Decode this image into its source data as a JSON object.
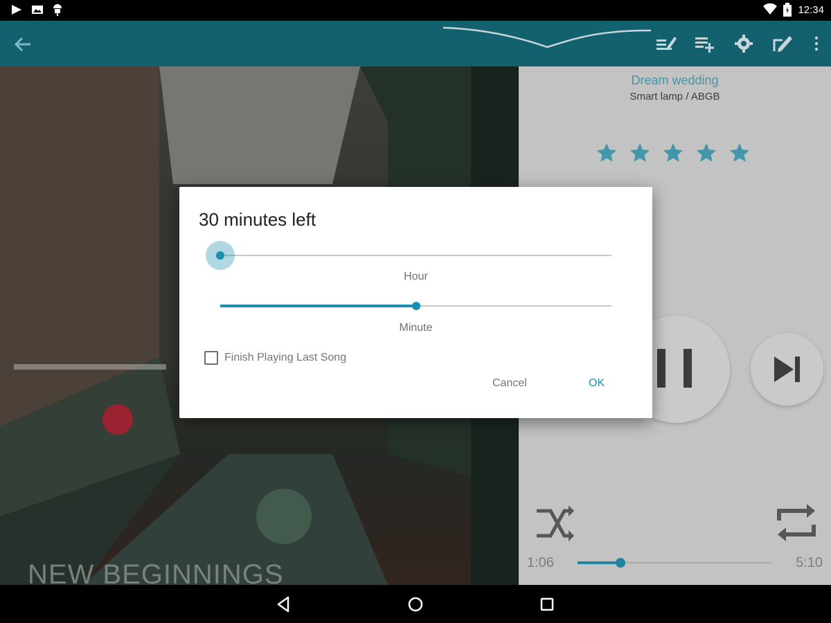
{
  "status_bar": {
    "time": "12:34",
    "icons": [
      "play-store-icon",
      "photo-icon",
      "android-icon",
      "wifi-icon",
      "battery-icon"
    ]
  },
  "app_bar": {
    "icons": [
      "back-arrow-icon",
      "edit-tags-icon",
      "playlist-add-icon",
      "gear-icon",
      "edit-icon",
      "more-vert-icon"
    ]
  },
  "album": {
    "text": "NEW BEGINNINGS"
  },
  "player": {
    "track_title": "Dream wedding",
    "track_subtitle": "Smart lamp / ABGB",
    "rating": 5,
    "rating_max": 5,
    "current_time": "1:06",
    "total_time": "5:10",
    "progress": 0.22
  },
  "dialog": {
    "title": "30 minutes left",
    "hour_label": "Hour",
    "hour_value": 0,
    "minute_label": "Minute",
    "minute_value": 0.5,
    "checkbox_label": "Finish Playing Last Song",
    "checkbox_checked": false,
    "cancel_label": "Cancel",
    "ok_label": "OK"
  },
  "colors": {
    "accent": "#1b8fb0",
    "app_bar": "#13606f",
    "title_link": "#3a7f90"
  }
}
